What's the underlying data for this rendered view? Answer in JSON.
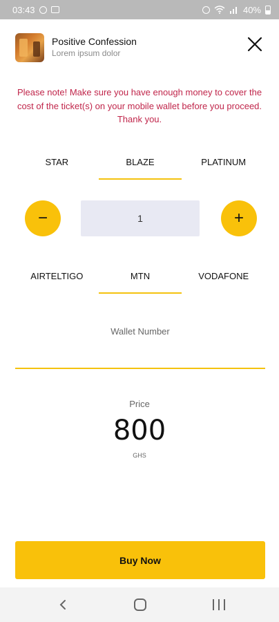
{
  "status_bar": {
    "time": "03:43",
    "battery": "40%",
    "icons": [
      "image-icon",
      "alarm-icon",
      "wifi-icon",
      "signal-icon",
      "battery-icon"
    ]
  },
  "header": {
    "title": "Positive Confession",
    "subtitle": "Lorem ipsum dolor",
    "close_icon": "close-icon"
  },
  "notice": "Please note! Make sure you have enough money to cover the cost of the ticket(s) on your mobile wallet before you proceed. Thank you.",
  "ticket_tabs": {
    "items": [
      "STAR",
      "BLAZE",
      "PLATINUM"
    ],
    "selected": "BLAZE"
  },
  "quantity": {
    "value": "1",
    "minus_symbol": "−",
    "plus_symbol": "+"
  },
  "network_tabs": {
    "items": [
      "AIRTELTIGO",
      "MTN",
      "VODAFONE"
    ],
    "selected": "MTN"
  },
  "wallet": {
    "label": "Wallet Number",
    "value": ""
  },
  "price": {
    "label": "Price",
    "value": "800",
    "currency": "GHS"
  },
  "buy_button": "Buy Now",
  "colors": {
    "accent": "#f9c10a",
    "notice": "#c0254a",
    "qty_bg": "#e8e9f3"
  }
}
